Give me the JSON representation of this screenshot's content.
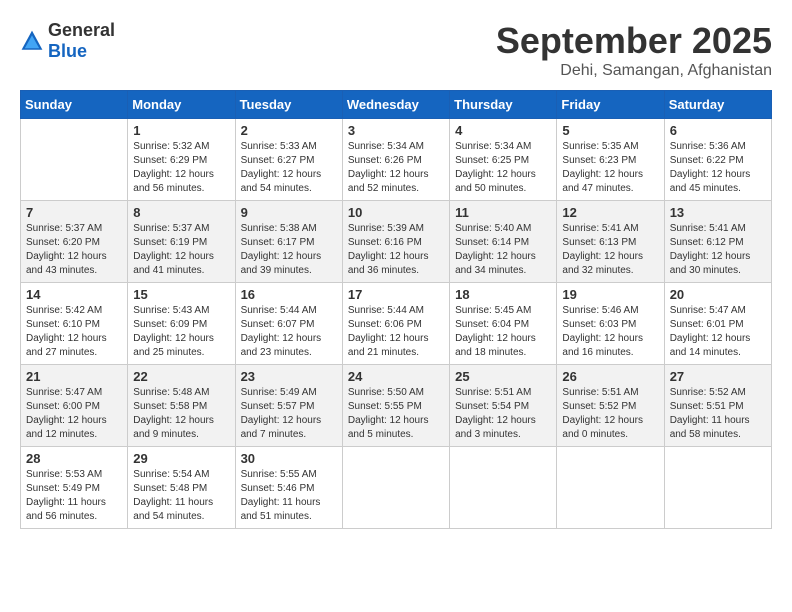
{
  "header": {
    "logo_general": "General",
    "logo_blue": "Blue",
    "month": "September 2025",
    "location": "Dehi, Samangan, Afghanistan"
  },
  "days_of_week": [
    "Sunday",
    "Monday",
    "Tuesday",
    "Wednesday",
    "Thursday",
    "Friday",
    "Saturday"
  ],
  "weeks": [
    [
      {
        "day": "",
        "sunrise": "",
        "sunset": "",
        "daylight": ""
      },
      {
        "day": "1",
        "sunrise": "Sunrise: 5:32 AM",
        "sunset": "Sunset: 6:29 PM",
        "daylight": "Daylight: 12 hours and 56 minutes."
      },
      {
        "day": "2",
        "sunrise": "Sunrise: 5:33 AM",
        "sunset": "Sunset: 6:27 PM",
        "daylight": "Daylight: 12 hours and 54 minutes."
      },
      {
        "day": "3",
        "sunrise": "Sunrise: 5:34 AM",
        "sunset": "Sunset: 6:26 PM",
        "daylight": "Daylight: 12 hours and 52 minutes."
      },
      {
        "day": "4",
        "sunrise": "Sunrise: 5:34 AM",
        "sunset": "Sunset: 6:25 PM",
        "daylight": "Daylight: 12 hours and 50 minutes."
      },
      {
        "day": "5",
        "sunrise": "Sunrise: 5:35 AM",
        "sunset": "Sunset: 6:23 PM",
        "daylight": "Daylight: 12 hours and 47 minutes."
      },
      {
        "day": "6",
        "sunrise": "Sunrise: 5:36 AM",
        "sunset": "Sunset: 6:22 PM",
        "daylight": "Daylight: 12 hours and 45 minutes."
      }
    ],
    [
      {
        "day": "7",
        "sunrise": "Sunrise: 5:37 AM",
        "sunset": "Sunset: 6:20 PM",
        "daylight": "Daylight: 12 hours and 43 minutes."
      },
      {
        "day": "8",
        "sunrise": "Sunrise: 5:37 AM",
        "sunset": "Sunset: 6:19 PM",
        "daylight": "Daylight: 12 hours and 41 minutes."
      },
      {
        "day": "9",
        "sunrise": "Sunrise: 5:38 AM",
        "sunset": "Sunset: 6:17 PM",
        "daylight": "Daylight: 12 hours and 39 minutes."
      },
      {
        "day": "10",
        "sunrise": "Sunrise: 5:39 AM",
        "sunset": "Sunset: 6:16 PM",
        "daylight": "Daylight: 12 hours and 36 minutes."
      },
      {
        "day": "11",
        "sunrise": "Sunrise: 5:40 AM",
        "sunset": "Sunset: 6:14 PM",
        "daylight": "Daylight: 12 hours and 34 minutes."
      },
      {
        "day": "12",
        "sunrise": "Sunrise: 5:41 AM",
        "sunset": "Sunset: 6:13 PM",
        "daylight": "Daylight: 12 hours and 32 minutes."
      },
      {
        "day": "13",
        "sunrise": "Sunrise: 5:41 AM",
        "sunset": "Sunset: 6:12 PM",
        "daylight": "Daylight: 12 hours and 30 minutes."
      }
    ],
    [
      {
        "day": "14",
        "sunrise": "Sunrise: 5:42 AM",
        "sunset": "Sunset: 6:10 PM",
        "daylight": "Daylight: 12 hours and 27 minutes."
      },
      {
        "day": "15",
        "sunrise": "Sunrise: 5:43 AM",
        "sunset": "Sunset: 6:09 PM",
        "daylight": "Daylight: 12 hours and 25 minutes."
      },
      {
        "day": "16",
        "sunrise": "Sunrise: 5:44 AM",
        "sunset": "Sunset: 6:07 PM",
        "daylight": "Daylight: 12 hours and 23 minutes."
      },
      {
        "day": "17",
        "sunrise": "Sunrise: 5:44 AM",
        "sunset": "Sunset: 6:06 PM",
        "daylight": "Daylight: 12 hours and 21 minutes."
      },
      {
        "day": "18",
        "sunrise": "Sunrise: 5:45 AM",
        "sunset": "Sunset: 6:04 PM",
        "daylight": "Daylight: 12 hours and 18 minutes."
      },
      {
        "day": "19",
        "sunrise": "Sunrise: 5:46 AM",
        "sunset": "Sunset: 6:03 PM",
        "daylight": "Daylight: 12 hours and 16 minutes."
      },
      {
        "day": "20",
        "sunrise": "Sunrise: 5:47 AM",
        "sunset": "Sunset: 6:01 PM",
        "daylight": "Daylight: 12 hours and 14 minutes."
      }
    ],
    [
      {
        "day": "21",
        "sunrise": "Sunrise: 5:47 AM",
        "sunset": "Sunset: 6:00 PM",
        "daylight": "Daylight: 12 hours and 12 minutes."
      },
      {
        "day": "22",
        "sunrise": "Sunrise: 5:48 AM",
        "sunset": "Sunset: 5:58 PM",
        "daylight": "Daylight: 12 hours and 9 minutes."
      },
      {
        "day": "23",
        "sunrise": "Sunrise: 5:49 AM",
        "sunset": "Sunset: 5:57 PM",
        "daylight": "Daylight: 12 hours and 7 minutes."
      },
      {
        "day": "24",
        "sunrise": "Sunrise: 5:50 AM",
        "sunset": "Sunset: 5:55 PM",
        "daylight": "Daylight: 12 hours and 5 minutes."
      },
      {
        "day": "25",
        "sunrise": "Sunrise: 5:51 AM",
        "sunset": "Sunset: 5:54 PM",
        "daylight": "Daylight: 12 hours and 3 minutes."
      },
      {
        "day": "26",
        "sunrise": "Sunrise: 5:51 AM",
        "sunset": "Sunset: 5:52 PM",
        "daylight": "Daylight: 12 hours and 0 minutes."
      },
      {
        "day": "27",
        "sunrise": "Sunrise: 5:52 AM",
        "sunset": "Sunset: 5:51 PM",
        "daylight": "Daylight: 11 hours and 58 minutes."
      }
    ],
    [
      {
        "day": "28",
        "sunrise": "Sunrise: 5:53 AM",
        "sunset": "Sunset: 5:49 PM",
        "daylight": "Daylight: 11 hours and 56 minutes."
      },
      {
        "day": "29",
        "sunrise": "Sunrise: 5:54 AM",
        "sunset": "Sunset: 5:48 PM",
        "daylight": "Daylight: 11 hours and 54 minutes."
      },
      {
        "day": "30",
        "sunrise": "Sunrise: 5:55 AM",
        "sunset": "Sunset: 5:46 PM",
        "daylight": "Daylight: 11 hours and 51 minutes."
      },
      {
        "day": "",
        "sunrise": "",
        "sunset": "",
        "daylight": ""
      },
      {
        "day": "",
        "sunrise": "",
        "sunset": "",
        "daylight": ""
      },
      {
        "day": "",
        "sunrise": "",
        "sunset": "",
        "daylight": ""
      },
      {
        "day": "",
        "sunrise": "",
        "sunset": "",
        "daylight": ""
      }
    ]
  ]
}
